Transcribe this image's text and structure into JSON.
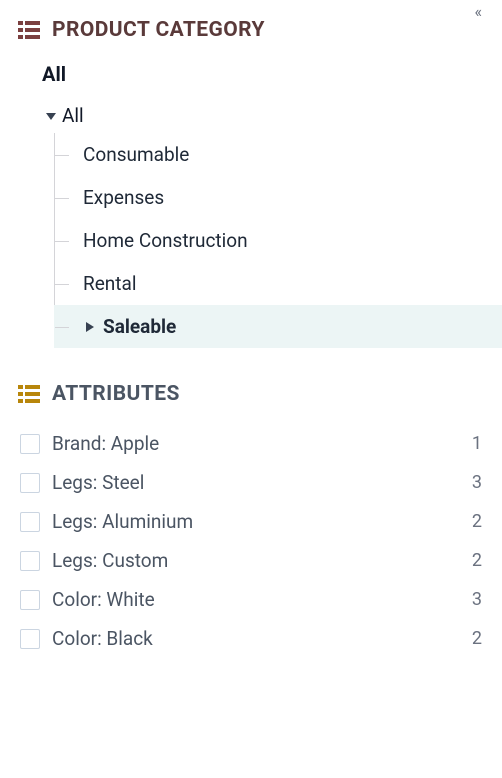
{
  "collapse_glyph": "«",
  "category": {
    "title": "PRODUCT CATEGORY",
    "root_label": "All",
    "tree": {
      "label": "All",
      "expanded": true,
      "children": [
        {
          "label": "Consumable"
        },
        {
          "label": "Expenses"
        },
        {
          "label": "Home Construction"
        },
        {
          "label": "Rental"
        },
        {
          "label": "Saleable",
          "has_children": true,
          "selected": true
        }
      ]
    }
  },
  "attributes": {
    "title": "ATTRIBUTES",
    "items": [
      {
        "label": "Brand: Apple",
        "count": 1
      },
      {
        "label": "Legs: Steel",
        "count": 3
      },
      {
        "label": "Legs: Aluminium",
        "count": 2
      },
      {
        "label": "Legs: Custom",
        "count": 2
      },
      {
        "label": "Color: White",
        "count": 3
      },
      {
        "label": "Color: Black",
        "count": 2
      }
    ]
  }
}
